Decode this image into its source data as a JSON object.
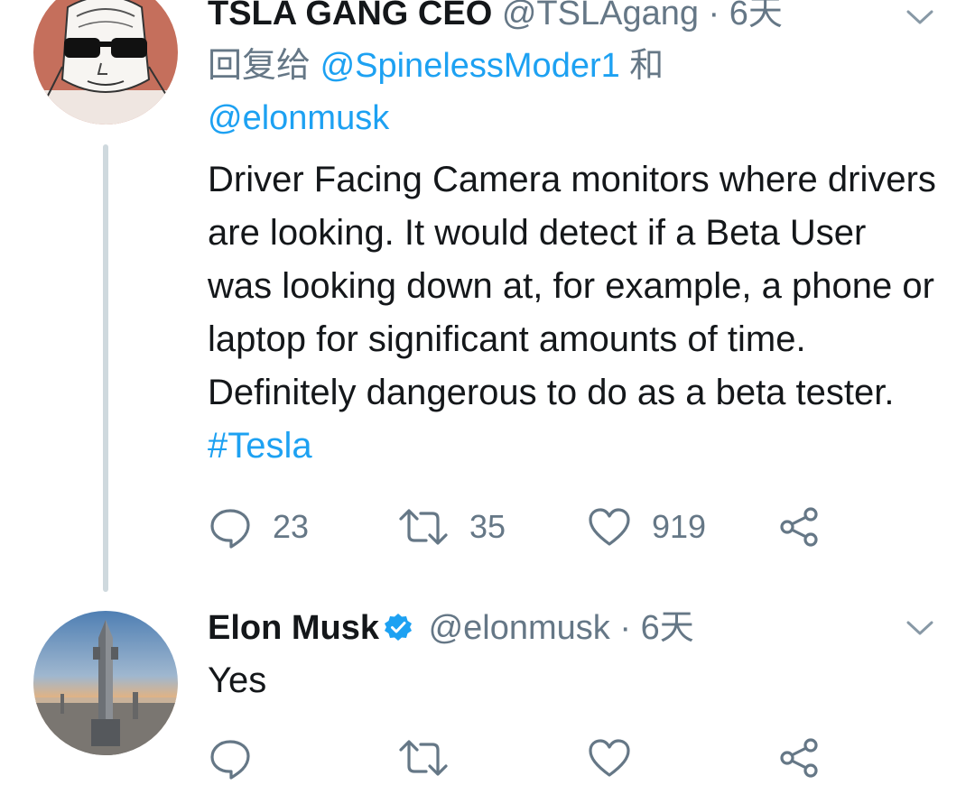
{
  "tweets": [
    {
      "name": "TSLA GANG CEO",
      "handle": "@TSLAgang",
      "dot": " · ",
      "time": "6天",
      "reply_prefix": "回复给 ",
      "reply_mention_1": "@SpinelessModer1",
      "reply_and": " 和",
      "reply_mention_2": "@elonmusk",
      "text": "Driver Facing Camera monitors where drivers are looking. It would detect if a Beta User was looking down at, for example, a phone or laptop for significant amounts of time. Definitely dangerous to do as a beta tester. ",
      "hashtag": "#Tesla",
      "replies": "23",
      "retweets": "35",
      "likes": "919"
    },
    {
      "name": "Elon Musk",
      "verified": true,
      "handle": "@elonmusk",
      "dot": " · ",
      "time": "6天",
      "text": "Yes"
    }
  ],
  "icons": {
    "reply": "comment-bubble-icon",
    "retweet": "retweet-icon",
    "like": "heart-icon",
    "share": "share-icon",
    "menu": "chevron-down-icon",
    "verified": "verified-badge-icon"
  },
  "colors": {
    "link": "#1da1f2",
    "muted": "#657786",
    "text": "#14171a",
    "thread_line": "#cfd9de"
  }
}
